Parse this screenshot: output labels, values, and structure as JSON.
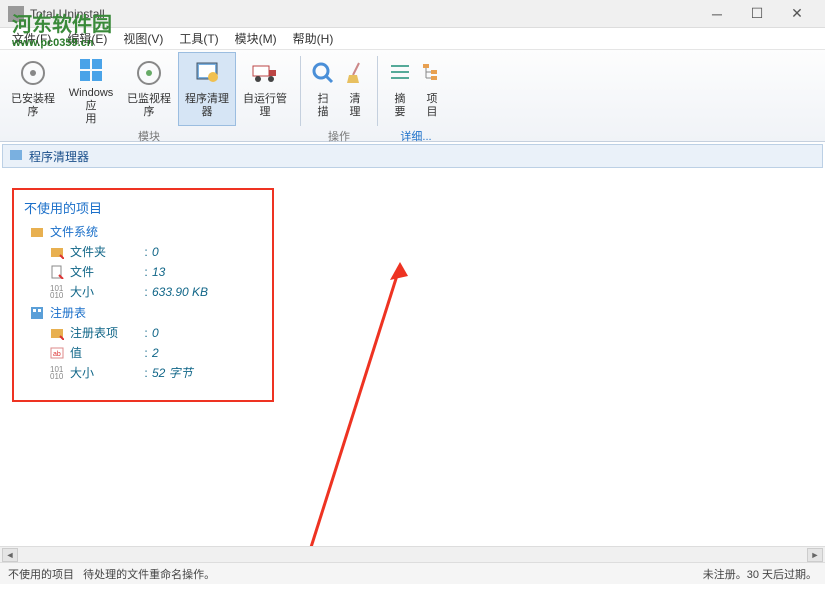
{
  "window": {
    "title": "Total Uninstall"
  },
  "watermark": {
    "text": "河东软件园",
    "url": "www.pc0359.cn"
  },
  "menu": {
    "file": "文件(F)",
    "edit": "编辑(E)",
    "view": "视图(V)",
    "tools": "工具(T)",
    "modules": "模块(M)",
    "help": "帮助(H)"
  },
  "ribbon": {
    "installed": "已安装程\n序",
    "winapps": "Windows 应\n用",
    "monitored": "已监视程\n序",
    "cleaner": "程序清理\n器",
    "autorun": "自运行管\n理",
    "group_modules": "模块",
    "scan": "扫\n描",
    "clean": "清\n理",
    "group_actions": "操作",
    "summary": "摘\n要",
    "items": "项\n目",
    "details": "详细..."
  },
  "breadcrumb": {
    "title": "程序清理器"
  },
  "panel": {
    "title": "不使用的项目",
    "filesystem": "文件系统",
    "folders_label": "文件夹",
    "folders_value": "0",
    "files_label": "文件",
    "files_value": "13",
    "size_label": "大小",
    "size_value": "633.90 KB",
    "registry": "注册表",
    "regitems_label": "注册表项",
    "regitems_value": "0",
    "values_label": "值",
    "values_value": "2",
    "regsize_label": "大小",
    "regsize_value": "52 字节"
  },
  "status": {
    "left1": "不使用的项目",
    "left2": "待处理的文件重命名操作。",
    "right": "未注册。30 天后过期。"
  }
}
